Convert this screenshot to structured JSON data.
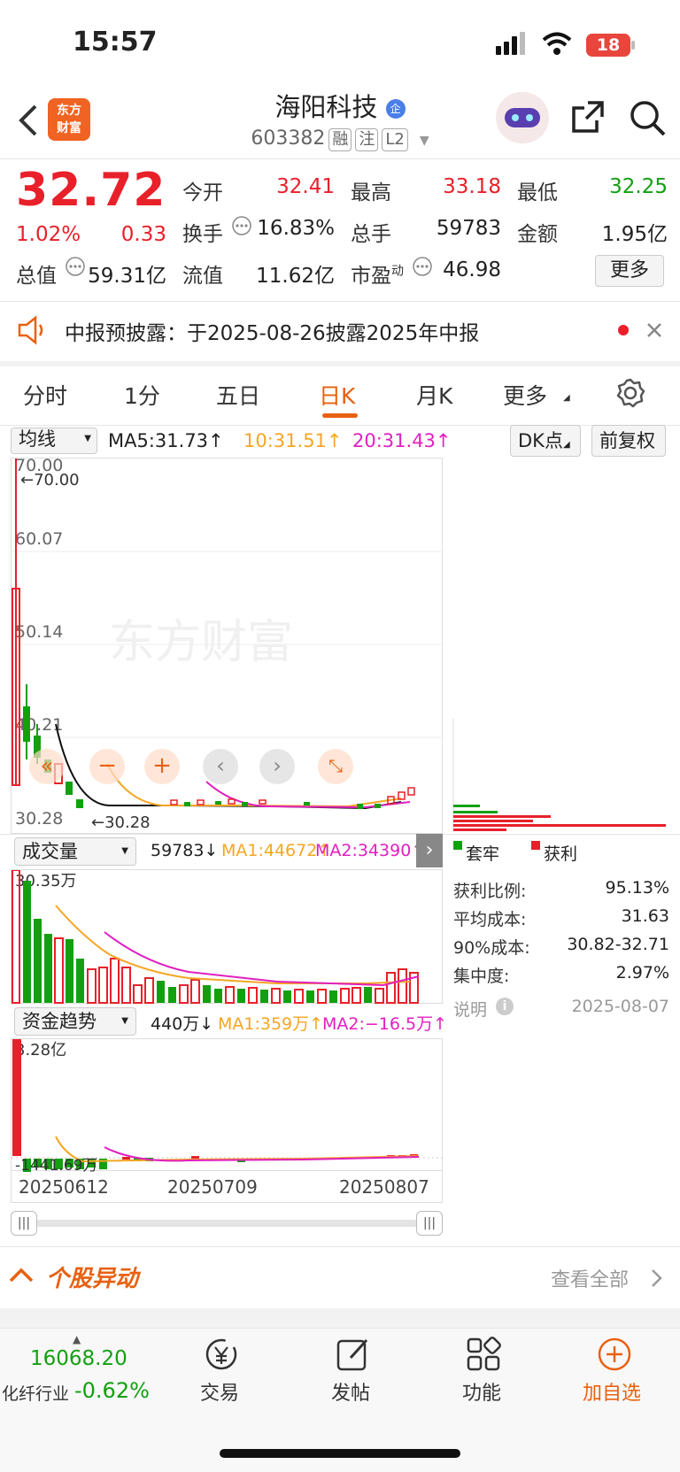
{
  "status": {
    "time": "15:57",
    "battery": "18"
  },
  "header": {
    "name": "海阳科技",
    "badge": "企",
    "code": "603382",
    "tag1": "融",
    "tag2": "注",
    "tag3": "L2",
    "logo_top": "东方",
    "logo_bottom": "财富"
  },
  "quote": {
    "price": "32.72",
    "change_pct": "1.02%",
    "change": "0.33",
    "open_label": "今开",
    "open": "32.41",
    "high_label": "最高",
    "high": "33.18",
    "low_label": "最低",
    "low": "32.25",
    "turnover_label": "换手",
    "turnover": "16.83%",
    "volume_label": "总手",
    "volume": "59783",
    "amount_label": "金额",
    "amount": "1.95亿",
    "mktcap_label": "总值",
    "mktcap": "59.31亿",
    "float_label": "流值",
    "float": "11.62亿",
    "pe_label": "市盈",
    "pe_sup": "动",
    "pe": "46.98",
    "more": "更多"
  },
  "notice": {
    "text": "中报预披露：于2025-08-26披露2025年中报"
  },
  "tabs": [
    "分时",
    "1分",
    "五日",
    "日K",
    "月K",
    "更多"
  ],
  "ma_bar": {
    "selector": "均线",
    "ma5": "MA5:31.73↑",
    "ma10": "10:31.51↑",
    "ma20": "20:31.43↑",
    "dk": "DK点",
    "fq": "前复权"
  },
  "kline": {
    "levels": [
      "70.00",
      "60.07",
      "50.14",
      "40.21",
      "30.28"
    ],
    "marker_high": "70.00",
    "marker_low": "30.28",
    "watermark": "东方财富"
  },
  "volume": {
    "selector": "成交量",
    "value": "59783↓",
    "ma1": "MA1:44672↑",
    "ma2": "MA2:34390↑",
    "top": "30.35万"
  },
  "fund": {
    "selector": "资金趋势",
    "value": "440万↓",
    "ma1": "MA1:359万↑",
    "ma2": "MA2:−16.5万↑",
    "top": "3.28亿",
    "bottom": "-1441.69万"
  },
  "dates": [
    "20250612",
    "20250709",
    "20250807"
  ],
  "chips": {
    "legend_trap": "套牢",
    "legend_profit": "获利",
    "rows": [
      {
        "k": "获利比例:",
        "v": "95.13%"
      },
      {
        "k": "平均成本:",
        "v": "31.63"
      },
      {
        "k": "90%成本:",
        "v": "30.82-32.71"
      },
      {
        "k": "集中度:",
        "v": "2.97%"
      }
    ],
    "note": "说明",
    "date": "2025-08-07"
  },
  "anomaly": {
    "title": "个股异动",
    "link": "查看全部"
  },
  "bottom": {
    "index_value": "16068.20",
    "index_name": "化纤行业",
    "index_change": "-0.62%",
    "trade": "交易",
    "post": "发帖",
    "func": "功能",
    "watch": "加自选"
  },
  "colors": {
    "up": "#e8202a",
    "down": "#13a010",
    "accent": "#e86111"
  }
}
